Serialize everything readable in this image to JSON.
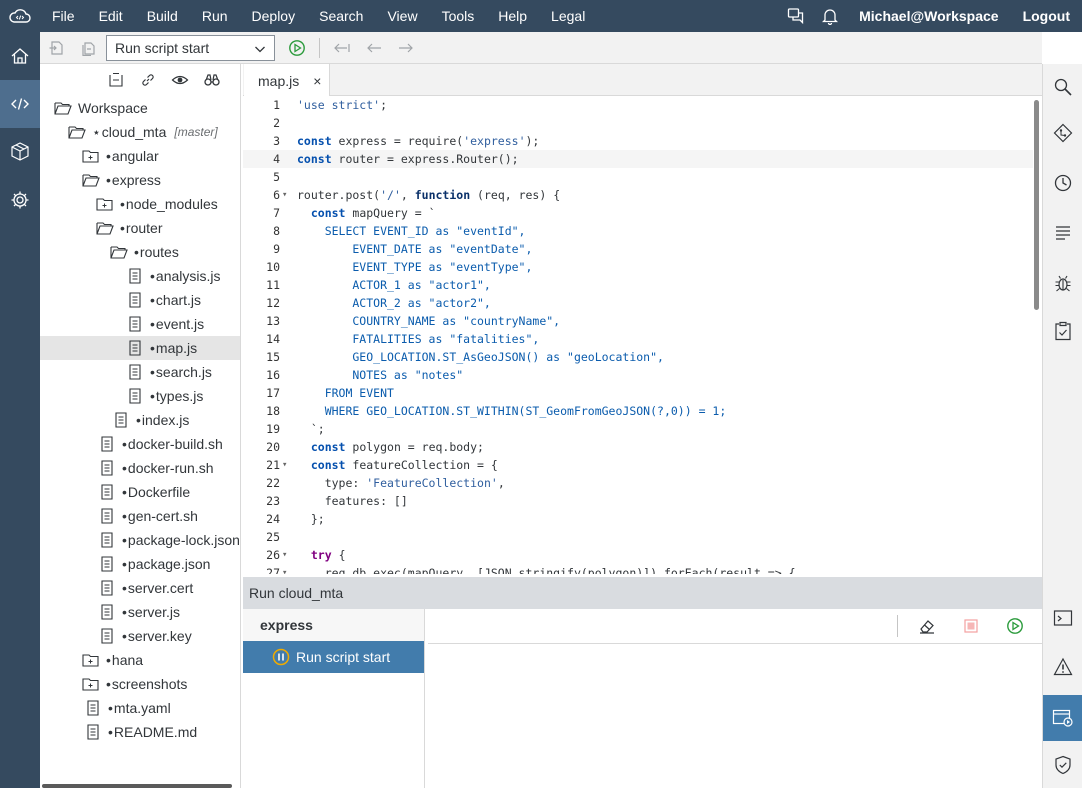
{
  "menu": {
    "items": [
      "File",
      "Edit",
      "Build",
      "Run",
      "Deploy",
      "Search",
      "View",
      "Tools",
      "Help",
      "Legal"
    ],
    "user": "Michael@Workspace",
    "logout": "Logout"
  },
  "toolbar": {
    "run_config": "Run script start"
  },
  "explorer": {
    "items": [
      {
        "label": "Workspace",
        "type": "folder-open"
      },
      {
        "label": "cloud_mta",
        "type": "folder-open",
        "branch": "[master]"
      },
      {
        "label": "angular",
        "type": "folder-closed"
      },
      {
        "label": "express",
        "type": "folder-open"
      },
      {
        "label": "node_modules",
        "type": "folder-closed"
      },
      {
        "label": "router",
        "type": "folder-open"
      },
      {
        "label": "routes",
        "type": "folder-open"
      },
      {
        "label": "analysis.js",
        "type": "file"
      },
      {
        "label": "chart.js",
        "type": "file"
      },
      {
        "label": "event.js",
        "type": "file"
      },
      {
        "label": "map.js",
        "type": "file"
      },
      {
        "label": "search.js",
        "type": "file"
      },
      {
        "label": "types.js",
        "type": "file"
      },
      {
        "label": "index.js",
        "type": "file"
      },
      {
        "label": "docker-build.sh",
        "type": "file"
      },
      {
        "label": "docker-run.sh",
        "type": "file"
      },
      {
        "label": "Dockerfile",
        "type": "file"
      },
      {
        "label": "gen-cert.sh",
        "type": "file"
      },
      {
        "label": "package-lock.json",
        "type": "file"
      },
      {
        "label": "package.json",
        "type": "file"
      },
      {
        "label": "server.cert",
        "type": "file"
      },
      {
        "label": "server.js",
        "type": "file"
      },
      {
        "label": "server.key",
        "type": "file"
      },
      {
        "label": "hana",
        "type": "folder-closed"
      },
      {
        "label": "screenshots",
        "type": "folder-closed"
      },
      {
        "label": "mta.yaml",
        "type": "file"
      },
      {
        "label": "README.md",
        "type": "file"
      }
    ]
  },
  "editor": {
    "tab_label": "map.js",
    "tab_close": "×",
    "lines": [
      {
        "n": "1",
        "fold": "",
        "code": "'use strict';"
      },
      {
        "n": "2",
        "fold": "",
        "code": ""
      },
      {
        "n": "3",
        "fold": "",
        "code": "const express = require('express');"
      },
      {
        "n": "4",
        "fold": "",
        "code": "const router = express.Router();"
      },
      {
        "n": "5",
        "fold": "",
        "code": ""
      },
      {
        "n": "6",
        "fold": "▾",
        "code": "router.post('/', function (req, res) {"
      },
      {
        "n": "7",
        "fold": "",
        "code": "  const mapQuery = `"
      },
      {
        "n": "8",
        "fold": "",
        "code": "    SELECT EVENT_ID as \"eventId\","
      },
      {
        "n": "9",
        "fold": "",
        "code": "        EVENT_DATE as \"eventDate\","
      },
      {
        "n": "10",
        "fold": "",
        "code": "        EVENT_TYPE as \"eventType\","
      },
      {
        "n": "11",
        "fold": "",
        "code": "        ACTOR_1 as \"actor1\","
      },
      {
        "n": "12",
        "fold": "",
        "code": "        ACTOR_2 as \"actor2\","
      },
      {
        "n": "13",
        "fold": "",
        "code": "        COUNTRY_NAME as \"countryName\","
      },
      {
        "n": "14",
        "fold": "",
        "code": "        FATALITIES as \"fatalities\","
      },
      {
        "n": "15",
        "fold": "",
        "code": "        GEO_LOCATION.ST_AsGeoJSON() as \"geoLocation\","
      },
      {
        "n": "16",
        "fold": "",
        "code": "        NOTES as \"notes\""
      },
      {
        "n": "17",
        "fold": "",
        "code": "    FROM EVENT"
      },
      {
        "n": "18",
        "fold": "",
        "code": "    WHERE GEO_LOCATION.ST_WITHIN(ST_GeomFromGeoJSON(?,0)) = 1;"
      },
      {
        "n": "19",
        "fold": "",
        "code": "  `;"
      },
      {
        "n": "20",
        "fold": "",
        "code": "  const polygon = req.body;"
      },
      {
        "n": "21",
        "fold": "▾",
        "code": "  const featureCollection = {"
      },
      {
        "n": "22",
        "fold": "",
        "code": "    type: 'FeatureCollection',"
      },
      {
        "n": "23",
        "fold": "",
        "code": "    features: []"
      },
      {
        "n": "24",
        "fold": "",
        "code": "  };"
      },
      {
        "n": "25",
        "fold": "",
        "code": ""
      },
      {
        "n": "26",
        "fold": "▾",
        "code": "  try {"
      },
      {
        "n": "27",
        "fold": "▾",
        "code": "    req.db.exec(mapQuery, [JSON.stringify(polygon)]).forEach(result => {"
      }
    ]
  },
  "run": {
    "panel_title": "Run cloud_mta",
    "group": "express",
    "config": "Run script start"
  },
  "colors": {
    "shell": "#354a5f",
    "accent": "#427cac",
    "run_green": "#2b9b3c"
  }
}
